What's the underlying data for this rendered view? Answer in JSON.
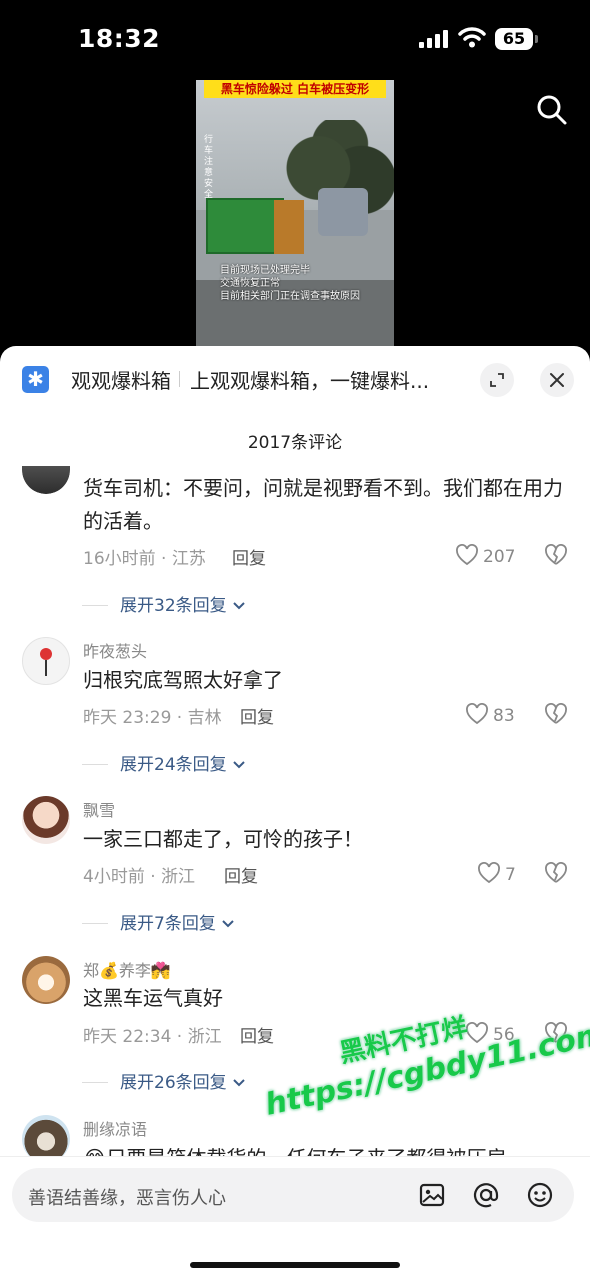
{
  "status_bar": {
    "time": "18:32",
    "battery": "65"
  },
  "video": {
    "banner": "黑车惊险躲过 白车被压变形",
    "side_text": "行车注意安全",
    "captions": [
      "目前现场已处理完毕",
      "交通恢复正常",
      "目前相关部门正在调查事故原因"
    ]
  },
  "sheet": {
    "app_name": "观观爆料箱",
    "subtitle": "上观观爆料箱，一键爆料...",
    "comment_count": "2017条评论"
  },
  "comments": [
    {
      "text": "货车司机：不要问，问就是视野看不到。我们都在用力的活着。",
      "meta": "16小时前 · 江苏",
      "reply": "回复",
      "likes": "207",
      "expand": "展开32条回复"
    },
    {
      "user": "昨夜葱头",
      "text": "归根究底驾照太好拿了",
      "meta": "昨天 23:29 · 吉林",
      "reply": "回复",
      "likes": "83",
      "expand": "展开24条回复"
    },
    {
      "user": "飘雪",
      "text": "一家三口都走了，可怜的孩子！",
      "meta": "4小时前 · 浙江",
      "reply": "回复",
      "likes": "7",
      "expand": "展开7条回复"
    },
    {
      "user": "郑💰养李💏",
      "text": "这黑车运气真好",
      "meta": "昨天 22:34 · 浙江",
      "reply": "回复",
      "likes": "56",
      "expand": "展开26条回复"
    },
    {
      "user": "删缘凉语",
      "text": "😂只要是箱体载货的，任何车子来了都得被压扁"
    }
  ],
  "input": {
    "placeholder": "善语结善缘，恶言伤人心"
  },
  "watermark": {
    "line1": "黑料不打烊",
    "line2": "https://cgbdy11.com"
  },
  "icons": [
    "search-icon",
    "expand-icon",
    "close-icon",
    "heart-icon",
    "broken-heart-icon",
    "chevron-down-icon",
    "image-icon",
    "at-icon",
    "emoji-icon"
  ]
}
